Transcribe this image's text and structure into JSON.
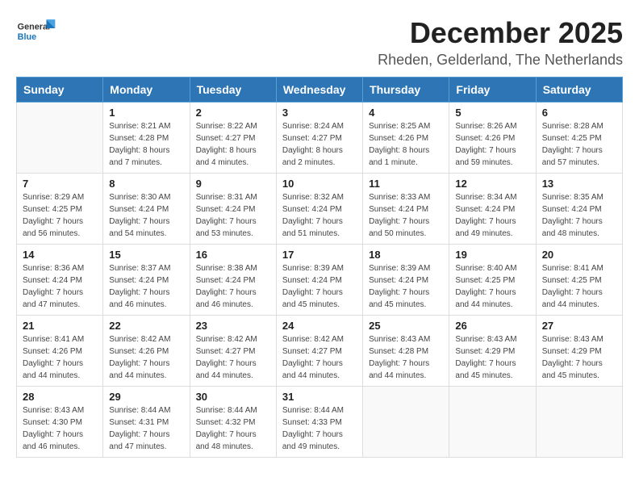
{
  "logo": {
    "general": "General",
    "blue": "Blue"
  },
  "title": "December 2025",
  "subtitle": "Rheden, Gelderland, The Netherlands",
  "header_days": [
    "Sunday",
    "Monday",
    "Tuesday",
    "Wednesday",
    "Thursday",
    "Friday",
    "Saturday"
  ],
  "weeks": [
    [
      {
        "day": "",
        "info": ""
      },
      {
        "day": "1",
        "info": "Sunrise: 8:21 AM\nSunset: 4:28 PM\nDaylight: 8 hours\nand 7 minutes."
      },
      {
        "day": "2",
        "info": "Sunrise: 8:22 AM\nSunset: 4:27 PM\nDaylight: 8 hours\nand 4 minutes."
      },
      {
        "day": "3",
        "info": "Sunrise: 8:24 AM\nSunset: 4:27 PM\nDaylight: 8 hours\nand 2 minutes."
      },
      {
        "day": "4",
        "info": "Sunrise: 8:25 AM\nSunset: 4:26 PM\nDaylight: 8 hours\nand 1 minute."
      },
      {
        "day": "5",
        "info": "Sunrise: 8:26 AM\nSunset: 4:26 PM\nDaylight: 7 hours\nand 59 minutes."
      },
      {
        "day": "6",
        "info": "Sunrise: 8:28 AM\nSunset: 4:25 PM\nDaylight: 7 hours\nand 57 minutes."
      }
    ],
    [
      {
        "day": "7",
        "info": "Sunrise: 8:29 AM\nSunset: 4:25 PM\nDaylight: 7 hours\nand 56 minutes."
      },
      {
        "day": "8",
        "info": "Sunrise: 8:30 AM\nSunset: 4:24 PM\nDaylight: 7 hours\nand 54 minutes."
      },
      {
        "day": "9",
        "info": "Sunrise: 8:31 AM\nSunset: 4:24 PM\nDaylight: 7 hours\nand 53 minutes."
      },
      {
        "day": "10",
        "info": "Sunrise: 8:32 AM\nSunset: 4:24 PM\nDaylight: 7 hours\nand 51 minutes."
      },
      {
        "day": "11",
        "info": "Sunrise: 8:33 AM\nSunset: 4:24 PM\nDaylight: 7 hours\nand 50 minutes."
      },
      {
        "day": "12",
        "info": "Sunrise: 8:34 AM\nSunset: 4:24 PM\nDaylight: 7 hours\nand 49 minutes."
      },
      {
        "day": "13",
        "info": "Sunrise: 8:35 AM\nSunset: 4:24 PM\nDaylight: 7 hours\nand 48 minutes."
      }
    ],
    [
      {
        "day": "14",
        "info": "Sunrise: 8:36 AM\nSunset: 4:24 PM\nDaylight: 7 hours\nand 47 minutes."
      },
      {
        "day": "15",
        "info": "Sunrise: 8:37 AM\nSunset: 4:24 PM\nDaylight: 7 hours\nand 46 minutes."
      },
      {
        "day": "16",
        "info": "Sunrise: 8:38 AM\nSunset: 4:24 PM\nDaylight: 7 hours\nand 46 minutes."
      },
      {
        "day": "17",
        "info": "Sunrise: 8:39 AM\nSunset: 4:24 PM\nDaylight: 7 hours\nand 45 minutes."
      },
      {
        "day": "18",
        "info": "Sunrise: 8:39 AM\nSunset: 4:24 PM\nDaylight: 7 hours\nand 45 minutes."
      },
      {
        "day": "19",
        "info": "Sunrise: 8:40 AM\nSunset: 4:25 PM\nDaylight: 7 hours\nand 44 minutes."
      },
      {
        "day": "20",
        "info": "Sunrise: 8:41 AM\nSunset: 4:25 PM\nDaylight: 7 hours\nand 44 minutes."
      }
    ],
    [
      {
        "day": "21",
        "info": "Sunrise: 8:41 AM\nSunset: 4:26 PM\nDaylight: 7 hours\nand 44 minutes."
      },
      {
        "day": "22",
        "info": "Sunrise: 8:42 AM\nSunset: 4:26 PM\nDaylight: 7 hours\nand 44 minutes."
      },
      {
        "day": "23",
        "info": "Sunrise: 8:42 AM\nSunset: 4:27 PM\nDaylight: 7 hours\nand 44 minutes."
      },
      {
        "day": "24",
        "info": "Sunrise: 8:42 AM\nSunset: 4:27 PM\nDaylight: 7 hours\nand 44 minutes."
      },
      {
        "day": "25",
        "info": "Sunrise: 8:43 AM\nSunset: 4:28 PM\nDaylight: 7 hours\nand 44 minutes."
      },
      {
        "day": "26",
        "info": "Sunrise: 8:43 AM\nSunset: 4:29 PM\nDaylight: 7 hours\nand 45 minutes."
      },
      {
        "day": "27",
        "info": "Sunrise: 8:43 AM\nSunset: 4:29 PM\nDaylight: 7 hours\nand 45 minutes."
      }
    ],
    [
      {
        "day": "28",
        "info": "Sunrise: 8:43 AM\nSunset: 4:30 PM\nDaylight: 7 hours\nand 46 minutes."
      },
      {
        "day": "29",
        "info": "Sunrise: 8:44 AM\nSunset: 4:31 PM\nDaylight: 7 hours\nand 47 minutes."
      },
      {
        "day": "30",
        "info": "Sunrise: 8:44 AM\nSunset: 4:32 PM\nDaylight: 7 hours\nand 48 minutes."
      },
      {
        "day": "31",
        "info": "Sunrise: 8:44 AM\nSunset: 4:33 PM\nDaylight: 7 hours\nand 49 minutes."
      },
      {
        "day": "",
        "info": ""
      },
      {
        "day": "",
        "info": ""
      },
      {
        "day": "",
        "info": ""
      }
    ]
  ]
}
